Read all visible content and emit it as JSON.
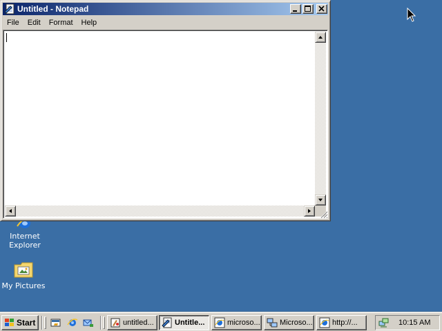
{
  "desktop": {
    "background_color": "#3a6ea5",
    "icons": [
      {
        "label_line1": "Internet",
        "label_line2": "Explorer",
        "icon": "internet-explorer-icon"
      },
      {
        "label": "My Pictures",
        "icon": "folder-pictures-icon"
      }
    ]
  },
  "notepad": {
    "title": "Untitled - Notepad",
    "menu": [
      "File",
      "Edit",
      "Format",
      "Help"
    ],
    "content": "",
    "caption_buttons": [
      "minimize",
      "maximize",
      "close"
    ]
  },
  "taskbar": {
    "start_label": "Start",
    "quick_launch": [
      "show-desktop-icon",
      "internet-explorer-icon",
      "outlook-express-icon"
    ],
    "tasks": [
      {
        "label": "untitled...",
        "icon": "paint-icon",
        "active": false
      },
      {
        "label": "Untitle...",
        "icon": "notepad-icon",
        "active": true
      },
      {
        "label": "microso...",
        "icon": "internet-explorer-icon",
        "active": false
      },
      {
        "label": "Microso...",
        "icon": "network-icon",
        "active": false
      },
      {
        "label": "http://...",
        "icon": "internet-explorer-icon",
        "active": false
      }
    ],
    "tray_icon": "network-tray-icon",
    "clock": "10:15 AM"
  }
}
